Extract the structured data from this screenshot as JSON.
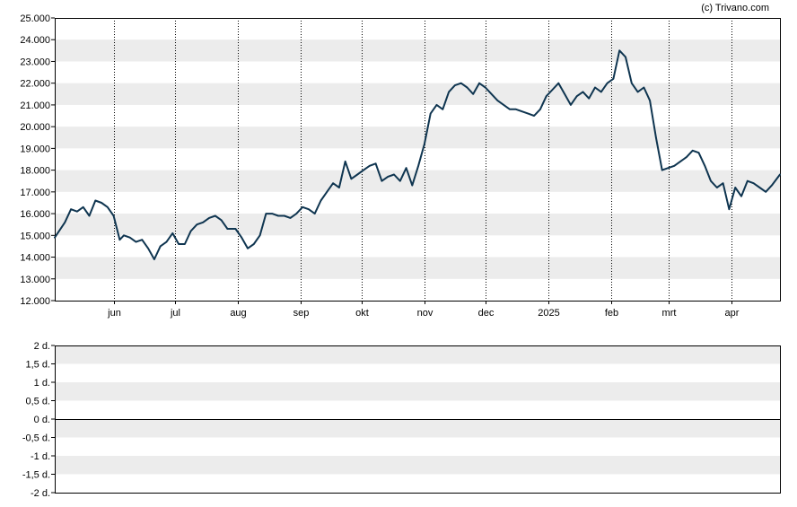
{
  "credit": "(c) Trivano.com",
  "colors": {
    "line": "#0f3550",
    "band": "#ececec",
    "grid": "#000000"
  },
  "chart_data": [
    {
      "type": "line",
      "title": "",
      "xlabel": "",
      "ylabel": "",
      "ylim": [
        12000,
        25000
      ],
      "y_ticks": [
        "12.000",
        "13.000",
        "14.000",
        "15.000",
        "16.000",
        "17.000",
        "18.000",
        "19.000",
        "20.000",
        "21.000",
        "22.000",
        "23.000",
        "24.000",
        "25.000"
      ],
      "x_ticks": [
        {
          "label": "jun",
          "date": "2024-06-01"
        },
        {
          "label": "jul",
          "date": "2024-07-01"
        },
        {
          "label": "aug",
          "date": "2024-08-01"
        },
        {
          "label": "sep",
          "date": "2024-09-01"
        },
        {
          "label": "okt",
          "date": "2024-10-01"
        },
        {
          "label": "nov",
          "date": "2024-11-01"
        },
        {
          "label": "dec",
          "date": "2024-12-01"
        },
        {
          "label": "2025",
          "date": "2025-01-01"
        },
        {
          "label": "feb",
          "date": "2025-02-01"
        },
        {
          "label": "mrt",
          "date": "2025-03-01"
        },
        {
          "label": "apr",
          "date": "2025-04-01"
        }
      ],
      "x_range": [
        "2024-05-03",
        "2025-04-25"
      ],
      "background": "alternating horizontal bands, vertical dotted lines at month ticks",
      "series": [
        {
          "x": [
            "2024-05-03",
            "2024-05-08",
            "2024-05-11",
            "2024-05-14",
            "2024-05-17",
            "2024-05-20",
            "2024-05-23",
            "2024-05-26",
            "2024-05-29",
            "2024-06-01",
            "2024-06-04",
            "2024-06-06",
            "2024-06-09",
            "2024-06-12",
            "2024-06-15",
            "2024-06-18",
            "2024-06-21",
            "2024-06-24",
            "2024-06-27",
            "2024-06-30",
            "2024-07-03",
            "2024-07-06",
            "2024-07-09",
            "2024-07-12",
            "2024-07-15",
            "2024-07-18",
            "2024-07-21",
            "2024-07-24",
            "2024-07-27",
            "2024-07-31",
            "2024-08-03",
            "2024-08-06",
            "2024-08-09",
            "2024-08-12",
            "2024-08-15",
            "2024-08-18",
            "2024-08-21",
            "2024-08-24",
            "2024-08-27",
            "2024-08-30",
            "2024-09-02",
            "2024-09-05",
            "2024-09-08",
            "2024-09-11",
            "2024-09-14",
            "2024-09-17",
            "2024-09-20",
            "2024-09-23",
            "2024-09-26",
            "2024-09-29",
            "2024-10-02",
            "2024-10-05",
            "2024-10-08",
            "2024-10-11",
            "2024-10-14",
            "2024-10-17",
            "2024-10-20",
            "2024-10-23",
            "2024-10-26",
            "2024-10-29",
            "2024-11-01",
            "2024-11-04",
            "2024-11-07",
            "2024-11-10",
            "2024-11-13",
            "2024-11-16",
            "2024-11-19",
            "2024-11-22",
            "2024-11-25",
            "2024-11-28",
            "2024-12-01",
            "2024-12-04",
            "2024-12-07",
            "2024-12-10",
            "2024-12-13",
            "2024-12-16",
            "2024-12-19",
            "2024-12-22",
            "2024-12-25",
            "2024-12-28",
            "2024-12-31",
            "2025-01-03",
            "2025-01-06",
            "2025-01-09",
            "2025-01-12",
            "2025-01-15",
            "2025-01-18",
            "2025-01-21",
            "2025-01-24",
            "2025-01-27",
            "2025-01-30",
            "2025-02-02",
            "2025-02-05",
            "2025-02-08",
            "2025-02-11",
            "2025-02-14",
            "2025-02-17",
            "2025-02-20",
            "2025-02-23",
            "2025-02-26",
            "2025-03-01",
            "2025-03-04",
            "2025-03-07",
            "2025-03-10",
            "2025-03-13",
            "2025-03-16",
            "2025-03-19",
            "2025-03-22",
            "2025-03-25",
            "2025-03-28",
            "2025-03-31",
            "2025-04-03",
            "2025-04-06",
            "2025-04-09",
            "2025-04-12",
            "2025-04-15",
            "2025-04-18",
            "2025-04-21",
            "2025-04-25"
          ],
          "y": [
            14900,
            15600,
            16200,
            16100,
            16300,
            15900,
            16600,
            16500,
            16300,
            15900,
            14800,
            15000,
            14900,
            14700,
            14800,
            14400,
            13900,
            14500,
            14700,
            15100,
            14600,
            14600,
            15200,
            15500,
            15600,
            15800,
            15900,
            15700,
            15300,
            15300,
            14900,
            14400,
            14600,
            15000,
            16000,
            16000,
            15900,
            15900,
            15800,
            16000,
            16300,
            16200,
            16000,
            16600,
            17000,
            17400,
            17200,
            18400,
            17600,
            17800,
            18000,
            18200,
            18300,
            17500,
            17700,
            17800,
            17500,
            18100,
            17300,
            18200,
            19200,
            20600,
            21000,
            20800,
            21600,
            21900,
            22000,
            21800,
            21500,
            22000,
            21800,
            21500,
            21200,
            21000,
            20800,
            20800,
            20700,
            20600,
            20500,
            20800,
            21400,
            21700,
            22000,
            21500,
            21000,
            21400,
            21600,
            21300,
            21800,
            21600,
            22000,
            22200,
            23500,
            23200,
            22000,
            21600,
            21800,
            21200,
            19500,
            18000,
            18100,
            18200,
            18400,
            18600,
            18900,
            18800,
            18200,
            17500,
            17200,
            17400,
            16200,
            17200,
            16800,
            17500,
            17400,
            17200,
            17000,
            17300,
            17800
          ]
        }
      ]
    },
    {
      "type": "line",
      "title": "",
      "xlabel": "",
      "ylabel": "",
      "ylim": [
        -2,
        2
      ],
      "y_ticks": [
        "2 d.",
        "1,5 d.",
        "1 d.",
        "0,5 d.",
        "0 d.",
        "-0,5 d.",
        "-1 d.",
        "-1,5 d.",
        "-2 d."
      ],
      "baseline": 0,
      "series": []
    }
  ]
}
